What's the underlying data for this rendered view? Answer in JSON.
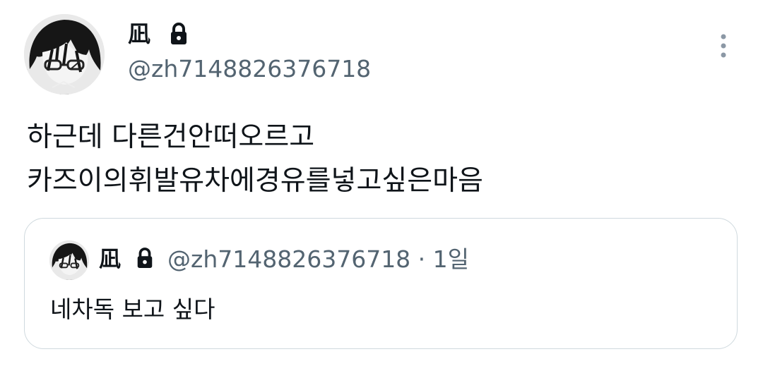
{
  "tweet": {
    "display_name": "凪",
    "handle": "@zh7148826376718",
    "locked_icon": "lock-icon",
    "body_lines": [
      "하근데 다른건안떠오르고",
      "카즈이의휘발유차에경유를넣고싶은마음"
    ],
    "more_icon": "more-vertical-icon"
  },
  "quote": {
    "display_name": "凪",
    "handle_time": "@zh7148826376718 · 1일",
    "text": "네차독 보고 싶다"
  },
  "colors": {
    "text_primary": "#0f1419",
    "text_secondary": "#536471",
    "border": "#cfd9de"
  }
}
